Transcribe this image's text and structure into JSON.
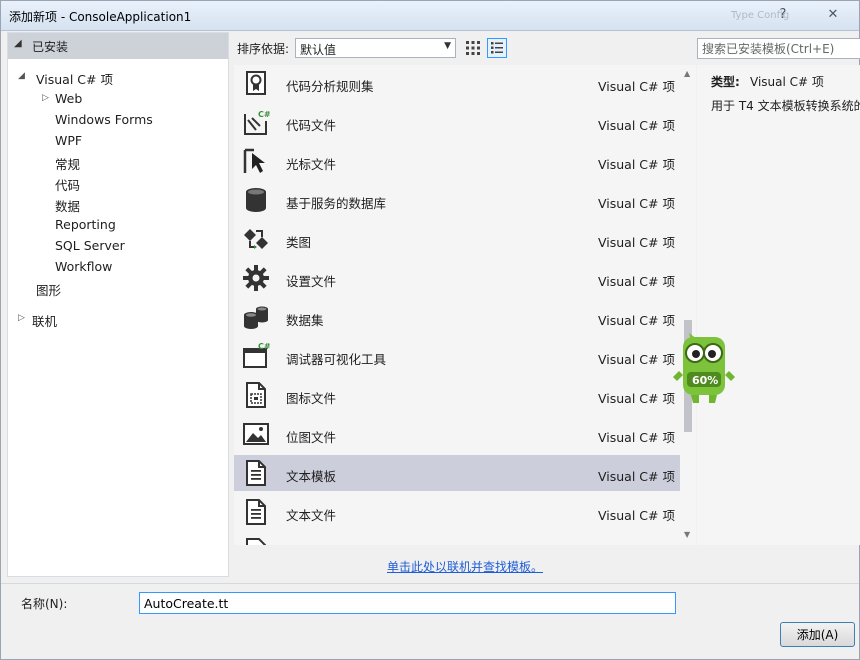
{
  "window": {
    "title": "添加新项 - ConsoleApplication1",
    "faded_overlay_text": "Type Config",
    "help_label": "?",
    "close_label": "✕"
  },
  "left_panel": {
    "installed_label": "已安装",
    "tree": [
      {
        "label": "Visual C# 项",
        "expanded": true
      },
      {
        "label": "Web",
        "collapsed_arrow": true
      },
      {
        "label": "Windows Forms"
      },
      {
        "label": "WPF"
      },
      {
        "label": "常规"
      },
      {
        "label": "代码"
      },
      {
        "label": "数据"
      },
      {
        "label": "Reporting"
      },
      {
        "label": "SQL Server"
      },
      {
        "label": "Workflow"
      },
      {
        "label": "图形"
      },
      {
        "label": "联机",
        "collapsed_arrow": true
      }
    ]
  },
  "toolbar": {
    "sort_label": "排序依据:",
    "sort_value": "默认值"
  },
  "search": {
    "placeholder": "搜索已安装模板(Ctrl+E)"
  },
  "items": [
    {
      "name": "代码分析规则集",
      "type": "Visual C# 项",
      "icon": "ruleset-icon"
    },
    {
      "name": "代码文件",
      "type": "Visual C# 项",
      "icon": "csharp-code-file-icon"
    },
    {
      "name": "光标文件",
      "type": "Visual C# 项",
      "icon": "cursor-file-icon"
    },
    {
      "name": "基于服务的数据库",
      "type": "Visual C# 项",
      "icon": "database-icon"
    },
    {
      "name": "类图",
      "type": "Visual C# 项",
      "icon": "class-diagram-icon"
    },
    {
      "name": "设置文件",
      "type": "Visual C# 项",
      "icon": "settings-gear-icon"
    },
    {
      "name": "数据集",
      "type": "Visual C# 项",
      "icon": "dataset-icon"
    },
    {
      "name": "调试器可视化工具",
      "type": "Visual C# 项",
      "icon": "debugger-visualizer-icon"
    },
    {
      "name": "图标文件",
      "type": "Visual C# 项",
      "icon": "icon-file-icon"
    },
    {
      "name": "位图文件",
      "type": "Visual C# 项",
      "icon": "bitmap-file-icon"
    },
    {
      "name": "文本模板",
      "type": "Visual C# 项",
      "icon": "text-template-icon",
      "selected": true
    },
    {
      "name": "文本文件",
      "type": "Visual C# 项",
      "icon": "text-file-icon"
    }
  ],
  "info": {
    "type_label": "类型:",
    "type_value": "Visual C# 项",
    "description": "用于 T4 文本模板转换系统的"
  },
  "mascot": {
    "percent_text": "60%"
  },
  "bottom": {
    "online_link": "单击此处以联机并查找模板。",
    "name_label": "名称(N):",
    "name_value": "AutoCreate.tt",
    "add_button": "添加(A)"
  },
  "colors": {
    "selected_row": "#cccedb",
    "link": "#1f5dd6",
    "mascot_green": "#7cc23a"
  }
}
